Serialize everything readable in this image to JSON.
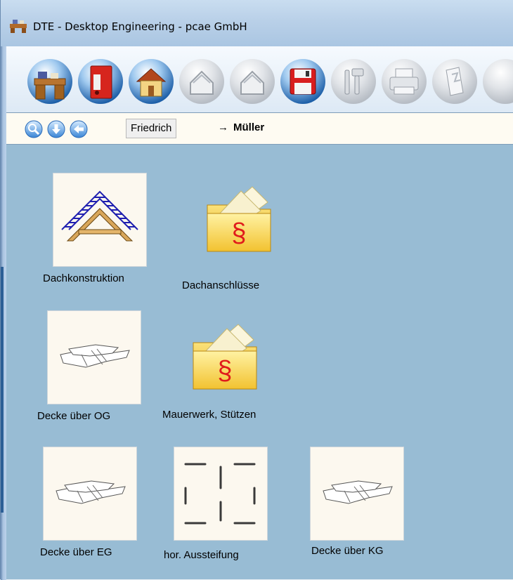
{
  "window": {
    "title": "DTE - Desktop Engineering - pcae GmbH",
    "title_icon": "desk-icon"
  },
  "toolbar": {
    "buttons": [
      {
        "name": "desk-button",
        "icon": "desk-icon",
        "enabled": true
      },
      {
        "name": "binder-button",
        "icon": "binder-icon",
        "enabled": true
      },
      {
        "name": "house-button",
        "icon": "house-icon",
        "enabled": true
      },
      {
        "name": "house-outline-button",
        "icon": "house-outline-icon",
        "enabled": false
      },
      {
        "name": "house-outline-button-2",
        "icon": "house-outline-icon",
        "enabled": false
      },
      {
        "name": "save-button",
        "icon": "floppy-disk-icon",
        "enabled": true
      },
      {
        "name": "tools-button",
        "icon": "tools-icon",
        "enabled": false
      },
      {
        "name": "print-button",
        "icon": "printer-icon",
        "enabled": false
      },
      {
        "name": "pages-button",
        "icon": "pages-icon",
        "enabled": false
      }
    ]
  },
  "nav": {
    "icons": [
      "search-icon",
      "arrow-down-icon",
      "arrow-left-icon"
    ],
    "breadcrumb_prev": "Friedrich",
    "breadcrumb_sep": "→",
    "breadcrumb_current": "Müller"
  },
  "items": [
    {
      "label": "Dachkonstruktion",
      "icon": "roof-construction-icon"
    },
    {
      "label": "Dachanschlüsse",
      "icon": "paragraph-folder-icon"
    },
    {
      "label": "Decke über OG",
      "icon": "slab-icon"
    },
    {
      "label": "Mauerwerk, Stützen",
      "icon": "paragraph-folder-icon"
    },
    {
      "label": "Decke über EG",
      "icon": "slab-icon"
    },
    {
      "label": "hor. Aussteifung",
      "icon": "bracing-icon"
    },
    {
      "label": "Decke über KG",
      "icon": "slab-icon"
    }
  ],
  "colors": {
    "content_bg": "#98bcd4",
    "tile_bg": "#fcf8ef",
    "navbar_bg": "#fefbf2",
    "paragraph_red": "#e01b1b",
    "roof_blue": "#1f1fb0"
  }
}
